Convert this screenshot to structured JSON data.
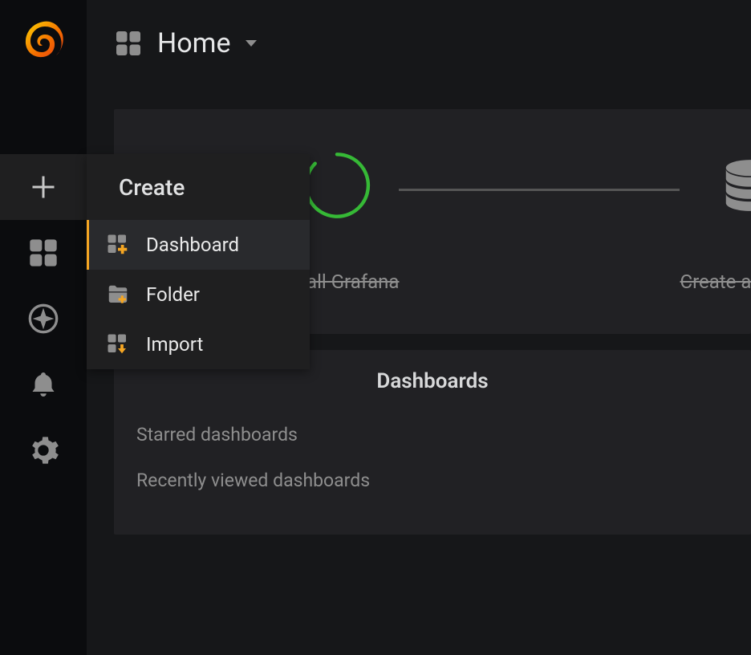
{
  "breadcrumb": {
    "title": "Home"
  },
  "flyout": {
    "header": "Create",
    "items": [
      {
        "label": "Dashboard"
      },
      {
        "label": "Folder"
      },
      {
        "label": "Import"
      }
    ]
  },
  "onboarding": {
    "step1": "Install Grafana",
    "step2": "Create a data so"
  },
  "dashboards": {
    "title": "Dashboards",
    "starred": "Starred dashboards",
    "recent": "Recently viewed dashboards"
  }
}
